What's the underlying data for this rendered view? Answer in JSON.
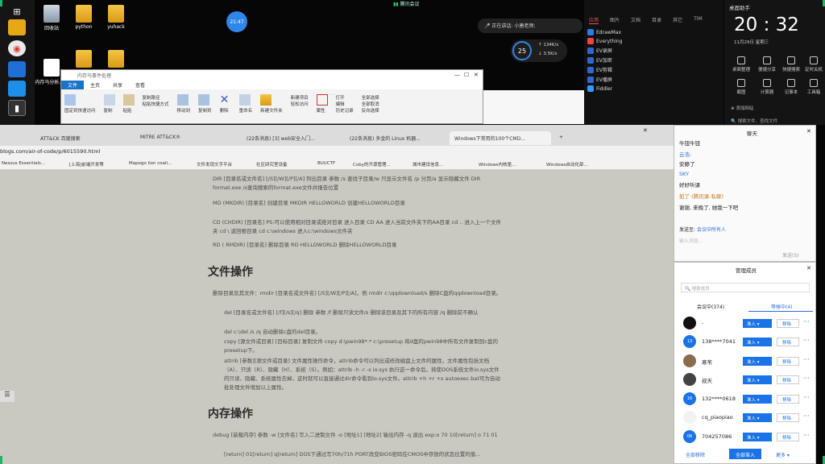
{
  "desktop": {
    "icons": [
      {
        "label": "回收站"
      },
      {
        "label": "python"
      },
      {
        "label": "yuhack"
      },
      {
        "label": "内存马分析.jpg"
      },
      {
        "label": ""
      },
      {
        "label": ""
      }
    ],
    "timer_badge": "21:47",
    "meeting_label": "腾讯会议",
    "speaking_text": "正在讲话: 小唐老师;",
    "net_percent": "25",
    "net_up": "134K/s",
    "net_down": "3.5K/s"
  },
  "explorer": {
    "title": "内存马事件处理",
    "tabs": [
      "文件",
      "主页",
      "共享",
      "查看"
    ],
    "ribbon": [
      {
        "label": "固定到快速访问"
      },
      {
        "label": "复制"
      },
      {
        "label": "粘贴"
      },
      {
        "label": "复制路径"
      },
      {
        "label": "粘贴快捷方式"
      },
      {
        "label": "移动到"
      },
      {
        "label": "复制到"
      },
      {
        "label": "删除"
      },
      {
        "label": "重命名"
      },
      {
        "label": "新建文件夹"
      },
      {
        "label": "新建项目"
      },
      {
        "label": "轻松访问"
      },
      {
        "label": "属性"
      },
      {
        "label": "打开"
      },
      {
        "label": "编辑"
      },
      {
        "label": "历史记录"
      },
      {
        "label": "全部选择"
      },
      {
        "label": "全部取消"
      },
      {
        "label": "反向选择"
      }
    ]
  },
  "meeting_toolbar": {
    "share_label": "分享"
  },
  "launcher": {
    "tabs": [
      "应用",
      "图片",
      "文档",
      "目录",
      "其它",
      "TIM"
    ],
    "apps": [
      "EdrawMax",
      "Everything",
      "EV录屏",
      "EV加密",
      "EV剪辑",
      "EV播屏",
      "Fiddler"
    ]
  },
  "clock": {
    "widget_title": "桌面助手",
    "time": "20 : 32",
    "date": "11月29日",
    "weekday": "星期三",
    "tools_row1": [
      "桌面整理",
      "便捷分享",
      "快捷搜索",
      "定时关机"
    ],
    "tools_row2": [
      "截图",
      "计算器",
      "记事本",
      "工具箱"
    ],
    "search_placeholder": "搜索文件、查找文件",
    "add_label": "添加网站"
  },
  "browser": {
    "tabs": [
      {
        "label": "ATT&CK 百度搜索"
      },
      {
        "label": "MITRE ATT&CK®"
      },
      {
        "label": "(22条消息) [3] web安全入门..."
      },
      {
        "label": "(22条消息) 多金的 Linux 机器..."
      },
      {
        "label": "Windows下常用的100个CMD..."
      }
    ],
    "url": "blogs.com/air-of-code/p/6015590.html",
    "bookmarks": [
      "Nessus Essentials...",
      "[上海]前端开发等",
      "Mapogo lion coali...",
      "文件发现文字平台",
      "社区研究室设备",
      "BUUCTF",
      "Coby的开源管理...",
      "城市建设信息...",
      "Windows内核驱...",
      "Windows自动化部..."
    ]
  },
  "article": {
    "para1": "DIR [目录名或文件名] [/S][/W][/P][/A] 列出目录 参数 /s 查找子目录/w 只显示文件名 /p 分页/a 显示隐藏文件 DIR format.exe /s查询搜索的format.exe文件并报告位置",
    "para2": "MD (MKDIR) [目录名] 创建目录 MKDIR HELLOWORLD 创建HELLOWORLD目录",
    "para3": "CD (CHDIR) [目录名] PS:可以使用相对目录或绝对目录 进入目录 CD AA 进入当前文件夹下的AA目录 cd .. 进入上一个文件夹 cd \\ 返回根目录 cd c:\\windows 进入c:\\windows文件夹",
    "para4": "RD ( RMDIR) [目录名] 删除目录 RD HELLOWORLD 删除HELLOWORLD目录",
    "heading1": "文件操作",
    "para5": "删除目录及其文件：rmdir [目录名或文件名] [/S][/W][/P][/A]，例 rmdir c:\\qqdownload/s 删除C盘的qqdownload目录。",
    "para6": "del [目录名或文件名] [/f][/s][/q] 删除 参数 /f 删除只读文件/s 删除该目录及其下的所有内容 /q 删除前不确认",
    "para7": "del c:\\del /s /q 自动删除c盘的del目录。",
    "para8": "copy [源文件或目录] [目标目录] 复制文件 copy d:\\pwin98*.* c:\\presetup 将d盘的pwin98中所有文件复制到c盘的presetup下。",
    "para9": "attrib [参数][源文件或目录] 文件属性操作命令，attrib命令可以列出或修改磁盘上文件的属性，文件属性包括文档（A）、只读（R）、隐藏（H）、系统（S）。例如：attrib -h -r -s io.sys 执行这一命令后，将使DOS系统文件io.sys文件的只读、隐藏、系统属性去掉，这时就可以直接通过dir命令看到io.sys文件。attrib +h +r +s autoexec.bat可为自动批处理文件增加以上属性。",
    "heading2": "内存操作",
    "para10": "debug [装载内存] 参数 -w [文件名] 写入二进制文件 -o [地址1] [地址2] 输出内存 -q 退出 exp:o 70 10[return] o 71 01",
    "para11": "[return] 01[return] q[return] DOS下通过写70h/71h PORT改变BIOS密码在CMOS中存放的状态位置的值..."
  },
  "chat": {
    "title": "聊天",
    "messages": [
      "牛钮牛钮",
      "云浩:",
      "安静了",
      "SKY",
      "好好听课",
      "如了 (腾讯课-私聊)",
      "谢谢, 来晚了, 她我一下吧"
    ],
    "send_to_label": "发送至:",
    "send_to_value": "会议中所有人",
    "input_placeholder": "输入消息...",
    "send_label": "发送(S)"
  },
  "members": {
    "title": "管理成员",
    "search_placeholder": "搜索成员",
    "tab_in": "会议中(374)",
    "tab_wait": "等候中(4)",
    "rows": [
      {
        "name": "-",
        "badge": ""
      },
      {
        "name": "138****7041",
        "badge": "13"
      },
      {
        "name": "寒苇",
        "badge": ""
      },
      {
        "name": "叔天",
        "badge": ""
      },
      {
        "name": "132****0618",
        "badge": "16"
      },
      {
        "name": "cq_piaopiao",
        "badge": ""
      },
      {
        "name": "704257086",
        "badge": "06"
      }
    ],
    "in_label": "准入",
    "remove_label": "移除",
    "footer": [
      "全部移除",
      "全部准入",
      "更多"
    ]
  }
}
